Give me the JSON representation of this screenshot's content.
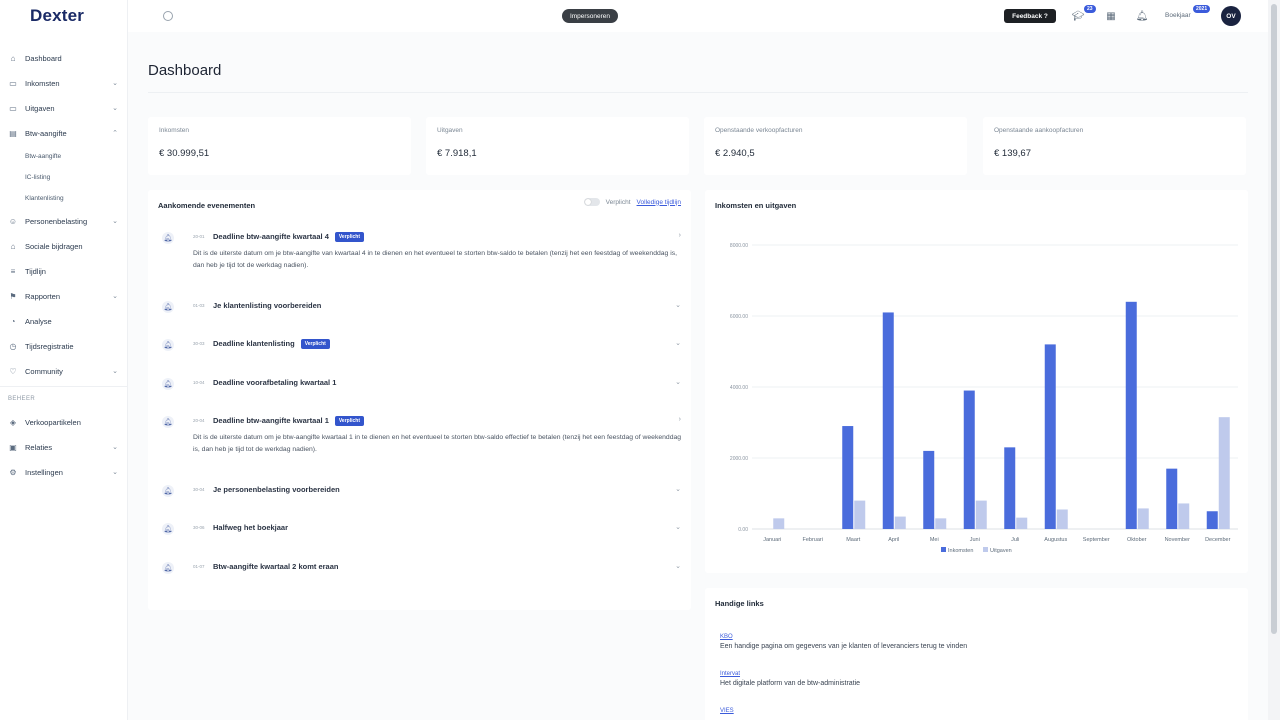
{
  "app": {
    "logo": "Dexter"
  },
  "sidebar": {
    "items": [
      {
        "label": "Dashboard",
        "icon": "home-icon"
      },
      {
        "label": "Inkomsten",
        "icon": "wallet-icon"
      },
      {
        "label": "Uitgaven",
        "icon": "wallet-icon"
      },
      {
        "label": "Btw-aangifte",
        "icon": "document-icon"
      },
      {
        "label": "Personenbelasting",
        "icon": "user-icon"
      },
      {
        "label": "Sociale bijdragen",
        "icon": "bank-icon"
      },
      {
        "label": "Tijdlijn",
        "icon": "list-icon"
      },
      {
        "label": "Rapporten",
        "icon": "flag-icon"
      },
      {
        "label": "Analyse",
        "icon": "pie-icon"
      },
      {
        "label": "Tijdsregistratie",
        "icon": "clock-icon"
      },
      {
        "label": "Community",
        "icon": "heart-icon"
      },
      {
        "label": "Verkoopartikelen",
        "icon": "tag-icon"
      },
      {
        "label": "Relaties",
        "icon": "contacts-icon"
      },
      {
        "label": "Instellingen",
        "icon": "gear-icon"
      }
    ],
    "btw_subitems": [
      "Btw-aangifte",
      "IC-listing",
      "Klantenlisting"
    ],
    "section_beheer": "BEHEER"
  },
  "topbar": {
    "impersonate_label": "Impersoneren",
    "feedback_label": "Feedback ?",
    "academy_badge": "23",
    "boekjaar_label": "Boekjaar",
    "boekjaar_badge": "2021",
    "avatar_initials": "OV"
  },
  "page": {
    "title": "Dashboard"
  },
  "stats": [
    {
      "label": "Inkomsten",
      "value": "€ 30.999,51"
    },
    {
      "label": "Uitgaven",
      "value": "€ 7.918,1"
    },
    {
      "label": "Openstaande verkoopfacturen",
      "value": "€ 2.940,5"
    },
    {
      "label": "Openstaande aankoopfacturen",
      "value": "€ 139,67"
    }
  ],
  "events": {
    "title": "Aankomende evenementen",
    "toggle_label": "Verplicht",
    "timeline_link": "Volledige tijdlijn",
    "tag_label": "Verplicht",
    "items": [
      {
        "date": "20-01",
        "title": "Deadline btw-aangifte kwartaal 4",
        "tag": true,
        "desc": "Dit is de uiterste datum om je btw-aangifte van kwartaal 4 in te dienen en het eventueel te storten btw-saldo te betalen (tenzij het een feestdag of weekenddag is, dan heb je tijd tot de werkdag nadien)."
      },
      {
        "date": "01-03",
        "title": "Je klantenlisting voorbereiden",
        "tag": false,
        "desc": ""
      },
      {
        "date": "30-03",
        "title": "Deadline klantenlisting",
        "tag": true,
        "desc": ""
      },
      {
        "date": "10-04",
        "title": "Deadline voorafbetaling kwartaal 1",
        "tag": false,
        "desc": ""
      },
      {
        "date": "20-04",
        "title": "Deadline btw-aangifte kwartaal 1",
        "tag": true,
        "desc": "Dit is de uiterste datum om je btw-aangifte kwartaal 1 in te dienen en het eventueel te storten btw-saldo effectief te betalen (tenzij het een feestdag of weekenddag is, dan heb je tijd tot de werkdag nadien)."
      },
      {
        "date": "30-04",
        "title": "Je personenbelasting voorbereiden",
        "tag": false,
        "desc": ""
      },
      {
        "date": "30-06",
        "title": "Halfweg het boekjaar",
        "tag": false,
        "desc": ""
      },
      {
        "date": "01-07",
        "title": "Btw-aangifte kwartaal 2 komt eraan",
        "tag": false,
        "desc": ""
      }
    ]
  },
  "chart_card": {
    "title": "Inkomsten en uitgaven"
  },
  "chart_data": {
    "type": "bar",
    "categories": [
      "Januari",
      "Februari",
      "Maart",
      "April",
      "Mei",
      "Juni",
      "Juli",
      "Augustus",
      "September",
      "Oktober",
      "November",
      "December"
    ],
    "series": [
      {
        "name": "Inkomsten",
        "color": "#4a6cdc",
        "values": [
          0,
          0,
          2900,
          6100,
          2200,
          3900,
          2300,
          5200,
          0,
          6400,
          1700,
          500
        ]
      },
      {
        "name": "Uitgaven",
        "color": "#bfcaec",
        "values": [
          300,
          0,
          800,
          350,
          300,
          800,
          320,
          550,
          0,
          580,
          720,
          3150
        ]
      }
    ],
    "yticks": [
      "0.00",
      "2000.00",
      "4000.00",
      "6000.00",
      "8000.00"
    ],
    "ylim": [
      0,
      8000
    ],
    "legend": "bottom"
  },
  "links": {
    "title": "Handige links",
    "items": [
      {
        "name": "KBO",
        "desc": "Een handige pagina om gegevens van je klanten of leveranciers terug te vinden"
      },
      {
        "name": "Intervat",
        "desc": "Het digitale platform van de btw-administratie"
      },
      {
        "name": "VIES",
        "desc": ""
      }
    ]
  }
}
